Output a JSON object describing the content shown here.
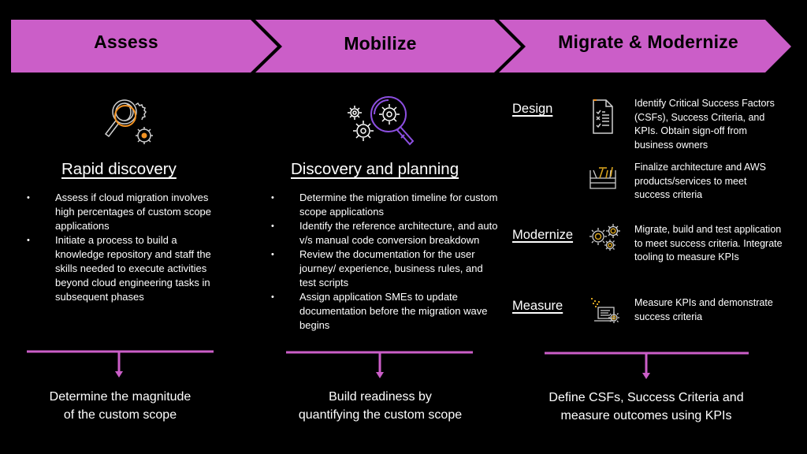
{
  "colors": {
    "accent": "#cb5ec8",
    "background": "#000000",
    "icon_orange": "#f29222",
    "icon_purple": "#8c4fe0",
    "icon_gold": "#d8a31f",
    "icon_gray": "#cfcfcf"
  },
  "phases": [
    {
      "label": "Assess"
    },
    {
      "label": "Mobilize"
    },
    {
      "label": "Migrate & Modernize"
    }
  ],
  "assess": {
    "icon": "magnifier-gears-icon",
    "title": "Rapid discovery",
    "bullets": [
      "Assess if cloud migration involves high percentages of custom scope applications",
      "Initiate a process to build a knowledge repository and staff the skills needed to execute activities beyond cloud engineering tasks in subsequent phases"
    ],
    "outcome_lines": [
      "Determine the magnitude",
      "of the custom scope"
    ]
  },
  "mobilize": {
    "icon": "gears-magnifier-icon",
    "title": "Discovery and planning",
    "bullets": [
      "Determine the migration timeline for custom scope applications",
      "Identify the reference architecture, and auto v/s manual code conversion breakdown",
      "Review the documentation for the user journey/ experience, business rules, and test scripts",
      "Assign application SMEs to update documentation before the migration wave begins"
    ],
    "outcome_lines": [
      "Build readiness by",
      "quantifying the custom scope"
    ]
  },
  "migrate": {
    "sections": [
      {
        "label": "Design",
        "items": [
          {
            "icon": "checklist-icon",
            "text": "Identify Critical Success Factors (CSFs), Success Criteria, and KPIs. Obtain sign-off from business owners"
          },
          {
            "icon": "toolbox-icon",
            "text": "Finalize architecture and AWS products/services to meet success criteria"
          }
        ]
      },
      {
        "label": "Modernize",
        "items": [
          {
            "icon": "gears-icon",
            "text": "Migrate, build and test application to meet success criteria. Integrate tooling to measure KPIs"
          }
        ]
      },
      {
        "label": "Measure",
        "items": [
          {
            "icon": "laptop-gear-icon",
            "text": "Measure KPIs and demonstrate success criteria"
          }
        ]
      }
    ],
    "outcome_lines": [
      "Define CSFs, Success Criteria and",
      "measure outcomes using KPIs"
    ]
  }
}
